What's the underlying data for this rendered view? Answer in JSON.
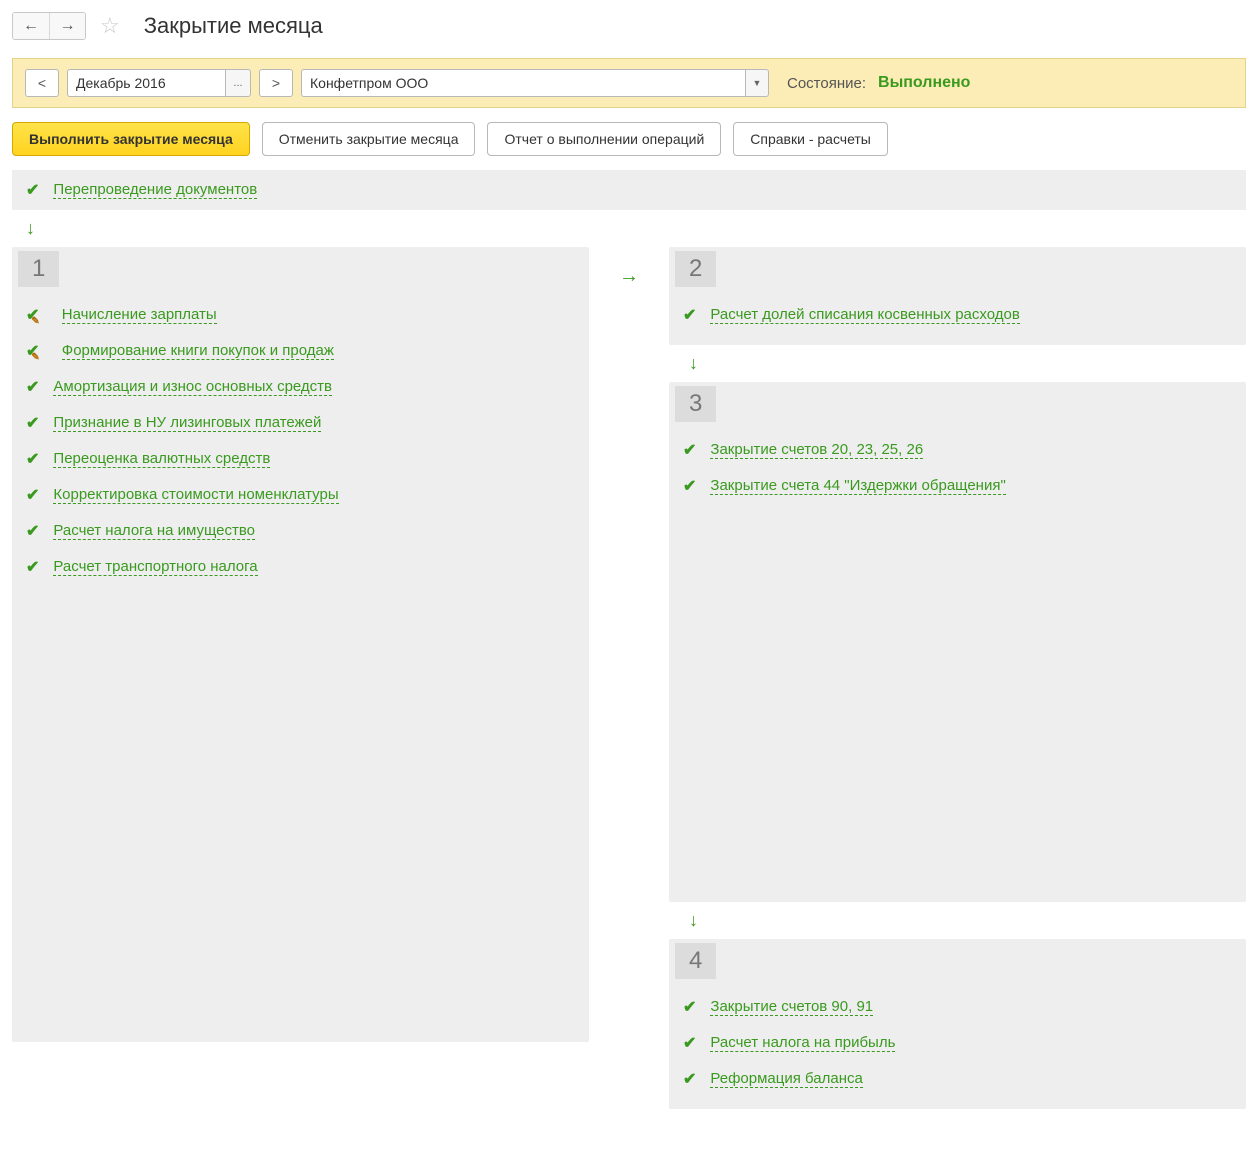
{
  "header": {
    "title": "Закрытие месяца"
  },
  "filter": {
    "prev": "<",
    "next": ">",
    "period": "Декабрь 2016",
    "period_picker": "...",
    "organization": "Конфетпром ООО",
    "status_label": "Состояние:",
    "status_value": "Выполнено"
  },
  "actions": {
    "execute": "Выполнить закрытие месяца",
    "cancel": "Отменить закрытие месяца",
    "report": "Отчет о выполнении операций",
    "calcrefs": "Справки - расчеты"
  },
  "top_op": {
    "label": "Перепроведение документов"
  },
  "stage1": {
    "num": "1",
    "items": [
      "Начисление зарплаты",
      "Формирование книги покупок и продаж",
      "Амортизация и износ основных средств",
      "Признание в НУ лизинговых платежей",
      "Переоценка валютных средств",
      "Корректировка стоимости номенклатуры",
      "Расчет налога на имущество",
      "Расчет транспортного налога"
    ]
  },
  "stage2": {
    "num": "2",
    "items": [
      "Расчет долей списания косвенных расходов"
    ]
  },
  "stage3": {
    "num": "3",
    "items": [
      "Закрытие счетов 20, 23, 25, 26",
      "Закрытие счета 44 \"Издержки обращения\""
    ]
  },
  "stage4": {
    "num": "4",
    "items": [
      "Закрытие счетов 90, 91",
      "Расчет налога на прибыль",
      "Реформация баланса"
    ]
  }
}
